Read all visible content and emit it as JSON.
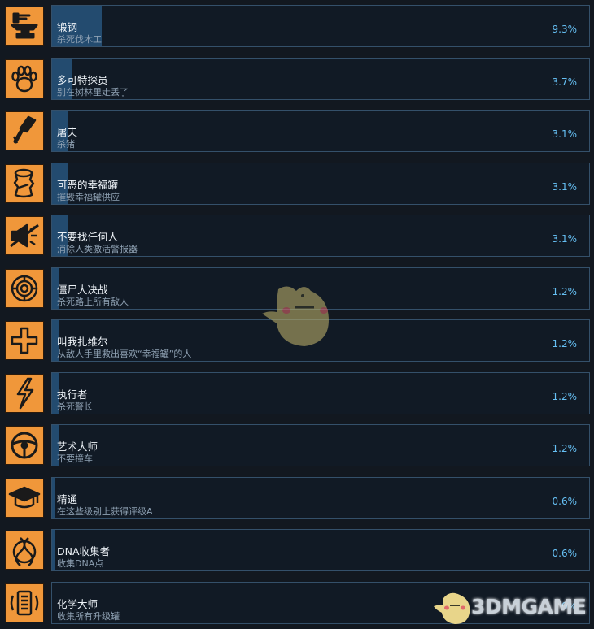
{
  "achievements": [
    {
      "title": "锻钢",
      "desc": "杀死伐木工",
      "pct": "9.3%",
      "pct_value": 9.3,
      "icon": "anvil-icon"
    },
    {
      "title": "多可特探员",
      "desc": "别在树林里走丢了",
      "pct": "3.7%",
      "pct_value": 3.7,
      "icon": "paw-print-icon"
    },
    {
      "title": "屠夫",
      "desc": "杀猪",
      "pct": "3.1%",
      "pct_value": 3.1,
      "icon": "cleaver-icon"
    },
    {
      "title": "可恶的幸福罐",
      "desc": "摧毁幸福罐供应",
      "pct": "3.1%",
      "pct_value": 3.1,
      "icon": "crushed-can-icon"
    },
    {
      "title": "不要找任何人",
      "desc": "消除人类激活警报器",
      "pct": "3.1%",
      "pct_value": 3.1,
      "icon": "broken-megaphone-icon"
    },
    {
      "title": "僵尸大决战",
      "desc": "杀死路上所有敌人",
      "pct": "1.2%",
      "pct_value": 1.2,
      "icon": "tire-icon"
    },
    {
      "title": "叫我扎维尔",
      "desc": "从敌人手里救出喜欢“幸福罐”的人",
      "pct": "1.2%",
      "pct_value": 1.2,
      "icon": "medical-cross-icon"
    },
    {
      "title": "执行者",
      "desc": "杀死警长",
      "pct": "1.2%",
      "pct_value": 1.2,
      "icon": "lightning-icon"
    },
    {
      "title": "艺术大师",
      "desc": "不要撞车",
      "pct": "1.2%",
      "pct_value": 1.2,
      "icon": "steering-wheel-icon"
    },
    {
      "title": "精通",
      "desc": "在这些级别上获得评级A",
      "pct": "0.6%",
      "pct_value": 0.6,
      "icon": "graduation-cap-icon"
    },
    {
      "title": "DNA收集者",
      "desc": "收集DNA点",
      "pct": "0.6%",
      "pct_value": 0.6,
      "icon": "dna-icon"
    },
    {
      "title": "化学大师",
      "desc": "收集所有升级罐",
      "pct": "0%",
      "pct_value": 0,
      "icon": "upgrade-canister-icon"
    }
  ],
  "watermark": {
    "logo_text": "3DMGAME"
  },
  "colors": {
    "background": "#121820",
    "panel": "#111a25",
    "panel_border": "#34506a",
    "progress_bar": "#234b6f",
    "icon_orange": "#f0973a",
    "title_text": "#eef3f8",
    "desc_text": "#8fa1b3",
    "percent_text": "#66c0f4"
  }
}
